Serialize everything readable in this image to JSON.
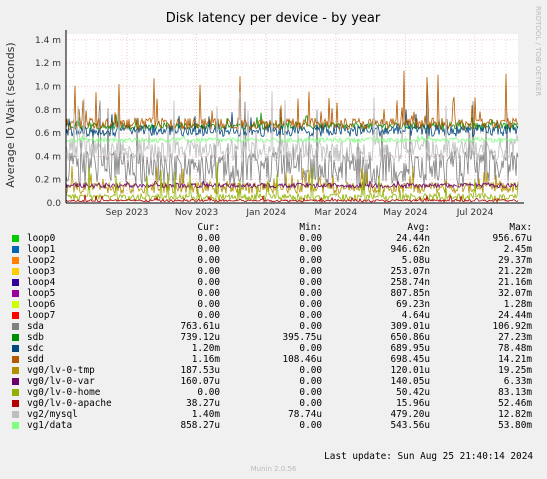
{
  "chart_data": {
    "type": "line",
    "title": "Disk latency per device - by year",
    "ylabel": "Average IO Wait (seconds)",
    "ylim": [
      0,
      1.45
    ],
    "yticks": [
      {
        "v": 0.0,
        "label": "0.0"
      },
      {
        "v": 0.2,
        "label": "0.2 m"
      },
      {
        "v": 0.4,
        "label": "0.4 m"
      },
      {
        "v": 0.6,
        "label": "0.6 m"
      },
      {
        "v": 0.8,
        "label": "0.8 m"
      },
      {
        "v": 1.0,
        "label": "1.0 m"
      },
      {
        "v": 1.2,
        "label": "1.2 m"
      },
      {
        "v": 1.4,
        "label": "1.4 m"
      }
    ],
    "xticks": [
      "Sep 2023",
      "Nov 2023",
      "Jan 2024",
      "Mar 2024",
      "May 2024",
      "Jul 2024"
    ],
    "grid": true,
    "series": [
      {
        "name": "loop0",
        "color": "#00cc00",
        "base": 0.0,
        "noise": 0.0,
        "spike": 0.0
      },
      {
        "name": "loop1",
        "color": "#0066b3",
        "base": 0.0,
        "noise": 0.0,
        "spike": 0.0
      },
      {
        "name": "loop2",
        "color": "#ff8000",
        "base": 0.0,
        "noise": 0.0,
        "spike": 0.0
      },
      {
        "name": "loop3",
        "color": "#ffcc00",
        "base": 0.0,
        "noise": 0.0,
        "spike": 0.0
      },
      {
        "name": "loop4",
        "color": "#330099",
        "base": 0.0,
        "noise": 0.0,
        "spike": 0.0
      },
      {
        "name": "loop5",
        "color": "#990099",
        "base": 0.0,
        "noise": 0.0,
        "spike": 0.0
      },
      {
        "name": "loop6",
        "color": "#ccff00",
        "base": 0.0,
        "noise": 0.0,
        "spike": 0.0
      },
      {
        "name": "loop7",
        "color": "#ff0000",
        "base": 0.0,
        "noise": 0.0,
        "spike": 0.0
      },
      {
        "name": "sda",
        "color": "#808080",
        "base": 0.3,
        "noise": 0.15,
        "spike": 0.6
      },
      {
        "name": "sdb",
        "color": "#008f00",
        "base": 0.66,
        "noise": 0.03,
        "spike": 0.1
      },
      {
        "name": "sdc",
        "color": "#00487d",
        "base": 0.62,
        "noise": 0.05,
        "spike": 0.15
      },
      {
        "name": "sdd",
        "color": "#b35a00",
        "base": 0.68,
        "noise": 0.05,
        "spike": 0.5
      },
      {
        "name": "vg0/lv-0-tmp",
        "color": "#b38f00",
        "base": 0.13,
        "noise": 0.05,
        "spike": 0.15
      },
      {
        "name": "vg0/lv-0-var",
        "color": "#6b006b",
        "base": 0.15,
        "noise": 0.02,
        "spike": 0.03
      },
      {
        "name": "vg0/lv-0-home",
        "color": "#8fb300",
        "base": 0.05,
        "noise": 0.03,
        "spike": 0.3
      },
      {
        "name": "vg0/lv-0-apache",
        "color": "#b30000",
        "base": 0.02,
        "noise": 0.01,
        "spike": 0.05
      },
      {
        "name": "vg2/mysql",
        "color": "#bebebe",
        "base": 0.45,
        "noise": 0.1,
        "spike": 0.5
      },
      {
        "name": "vg1/data",
        "color": "#80ff80",
        "base": 0.54,
        "noise": 0.02,
        "spike": 0.03
      }
    ]
  },
  "legend": {
    "headers": {
      "cur": "Cur:",
      "min": "Min:",
      "avg": "Avg:",
      "max": "Max:"
    },
    "rows": [
      {
        "name": "loop0",
        "color": "#00cc00",
        "cur": "0.00",
        "min": "0.00",
        "avg": "24.44n",
        "max": "956.67u"
      },
      {
        "name": "loop1",
        "color": "#0066b3",
        "cur": "0.00",
        "min": "0.00",
        "avg": "946.62n",
        "max": "2.45m"
      },
      {
        "name": "loop2",
        "color": "#ff8000",
        "cur": "0.00",
        "min": "0.00",
        "avg": "5.08u",
        "max": "29.37m"
      },
      {
        "name": "loop3",
        "color": "#ffcc00",
        "cur": "0.00",
        "min": "0.00",
        "avg": "253.07n",
        "max": "21.22m"
      },
      {
        "name": "loop4",
        "color": "#330099",
        "cur": "0.00",
        "min": "0.00",
        "avg": "258.74n",
        "max": "21.16m"
      },
      {
        "name": "loop5",
        "color": "#990099",
        "cur": "0.00",
        "min": "0.00",
        "avg": "807.85n",
        "max": "32.07m"
      },
      {
        "name": "loop6",
        "color": "#ccff00",
        "cur": "0.00",
        "min": "0.00",
        "avg": "69.23n",
        "max": "1.28m"
      },
      {
        "name": "loop7",
        "color": "#ff0000",
        "cur": "0.00",
        "min": "0.00",
        "avg": "4.64u",
        "max": "24.44m"
      },
      {
        "name": "sda",
        "color": "#808080",
        "cur": "763.61u",
        "min": "0.00",
        "avg": "309.01u",
        "max": "106.92m"
      },
      {
        "name": "sdb",
        "color": "#008f00",
        "cur": "739.12u",
        "min": "395.75u",
        "avg": "650.86u",
        "max": "27.23m"
      },
      {
        "name": "sdc",
        "color": "#00487d",
        "cur": "1.20m",
        "min": "0.00",
        "avg": "689.95u",
        "max": "78.48m"
      },
      {
        "name": "sdd",
        "color": "#b35a00",
        "cur": "1.16m",
        "min": "108.46u",
        "avg": "698.45u",
        "max": "14.21m"
      },
      {
        "name": "vg0/lv-0-tmp",
        "color": "#b38f00",
        "cur": "187.53u",
        "min": "0.00",
        "avg": "120.01u",
        "max": "19.25m"
      },
      {
        "name": "vg0/lv-0-var",
        "color": "#6b006b",
        "cur": "160.07u",
        "min": "0.00",
        "avg": "140.05u",
        "max": "6.33m"
      },
      {
        "name": "vg0/lv-0-home",
        "color": "#8fb300",
        "cur": "0.00",
        "min": "0.00",
        "avg": "50.42u",
        "max": "83.13m"
      },
      {
        "name": "vg0/lv-0-apache",
        "color": "#b30000",
        "cur": "38.27u",
        "min": "0.00",
        "avg": "15.96u",
        "max": "52.46m"
      },
      {
        "name": "vg2/mysql",
        "color": "#bebebe",
        "cur": "1.40m",
        "min": "78.74u",
        "avg": "479.20u",
        "max": "12.82m"
      },
      {
        "name": "vg1/data",
        "color": "#80ff80",
        "cur": "858.27u",
        "min": "0.00",
        "avg": "543.56u",
        "max": "53.80m"
      }
    ]
  },
  "footer": {
    "last_update": "Last update: Sun Aug 25 21:40:14 2024",
    "version": "Munin 2.0.56",
    "watermark": "RRDTOOL / TOBI OETIKER"
  }
}
